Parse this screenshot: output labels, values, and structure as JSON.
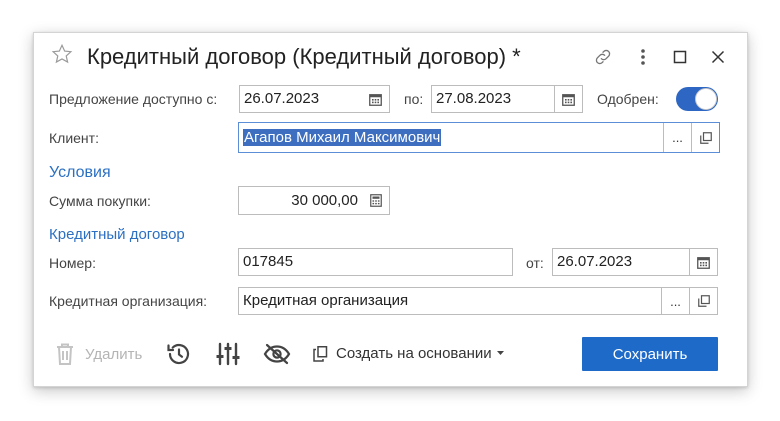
{
  "header": {
    "title": "Кредитный договор  (Кредитный договор) *",
    "icons": [
      "star-icon",
      "link-icon",
      "more-vertical-icon",
      "maximize-icon",
      "close-icon"
    ]
  },
  "offer": {
    "label": "Предложение доступно с:",
    "from_value": "26.07.2023",
    "to_label": "по:",
    "to_value": "27.08.2023",
    "approved_label": "Одобрен:",
    "approved": true
  },
  "client": {
    "label": "Клиент:",
    "value": "Агапов Михаил Максимович",
    "more_label": "...",
    "open_icon": "open-icon"
  },
  "conditions": {
    "section_title": "Условия",
    "amount_label": "Сумма покупки:",
    "amount_value": "30 000,00"
  },
  "credit": {
    "section_title": "Кредитный договор",
    "number_label": "Номер:",
    "number_value": "017845",
    "date_label": "от:",
    "date_value": "26.07.2023",
    "org_label": "Кредитная организация:",
    "org_value": "Кредитная организация",
    "more_label": "..."
  },
  "toolbar": {
    "delete_label": "Удалить",
    "create_based_label": "Создать на основании",
    "save_label": "Сохранить"
  },
  "colors": {
    "accent": "#1e6ac9",
    "section": "#2c70c2",
    "selection": "#3d6ec0"
  }
}
